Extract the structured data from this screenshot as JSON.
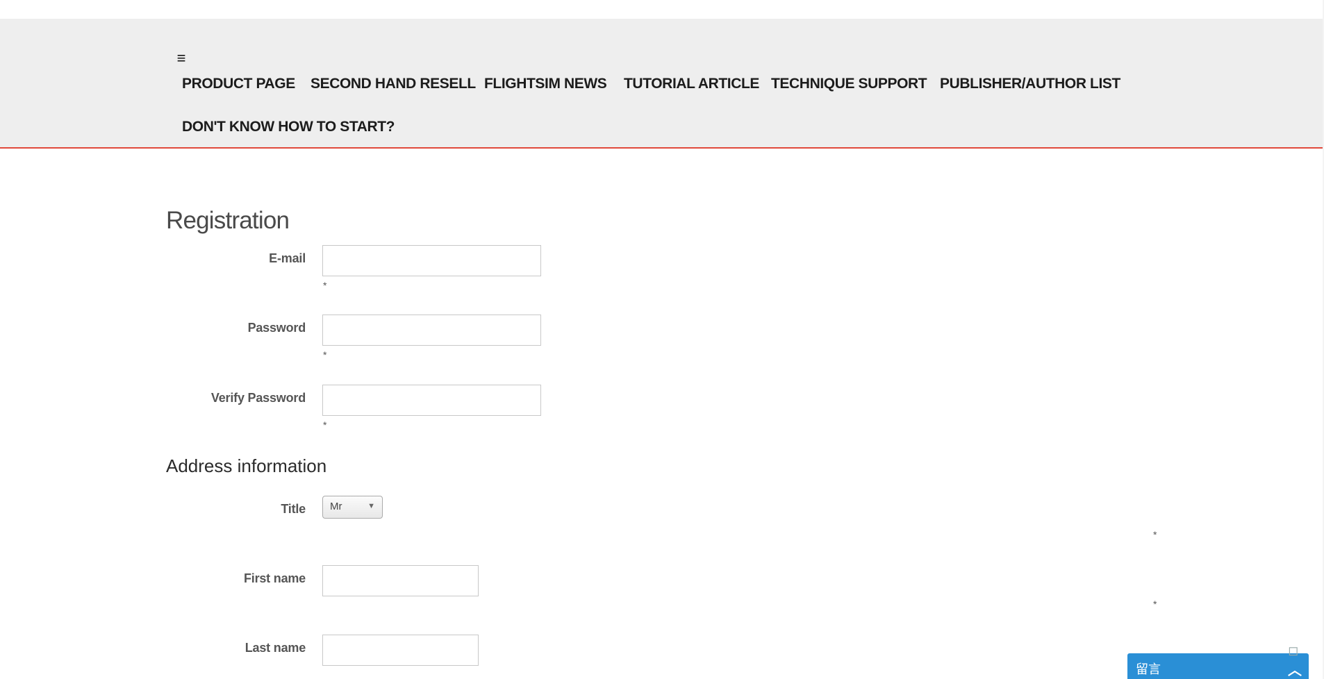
{
  "nav": {
    "toggle_icon": "≡",
    "items": [
      "PRODUCT PAGE",
      "SECOND HAND RESELL",
      "FLIGHTSIM NEWS",
      "TUTORIAL ARTICLE",
      "TECHNIQUE SUPPORT",
      "PUBLISHER/AUTHOR LIST",
      "DON'T KNOW HOW TO START?"
    ]
  },
  "registration": {
    "heading": "Registration",
    "email_label": "E-mail",
    "password_label": "Password",
    "verify_label": "Verify Password",
    "required_mark": "*",
    "email_value": "",
    "password_value": "",
    "verify_value": ""
  },
  "address": {
    "heading": "Address information",
    "title_label": "Title",
    "title_selected": "Mr",
    "first_name_label": "First name",
    "last_name_label": "Last name",
    "first_name_value": "",
    "last_name_value": "",
    "required_mark": "*"
  },
  "chat": {
    "label": "留言",
    "chevron_icon": "chevron-up-icon"
  },
  "colors": {
    "nav_bg": "#eeeeee",
    "nav_border": "#e0483a",
    "chat_bg": "#2a8fd6"
  }
}
